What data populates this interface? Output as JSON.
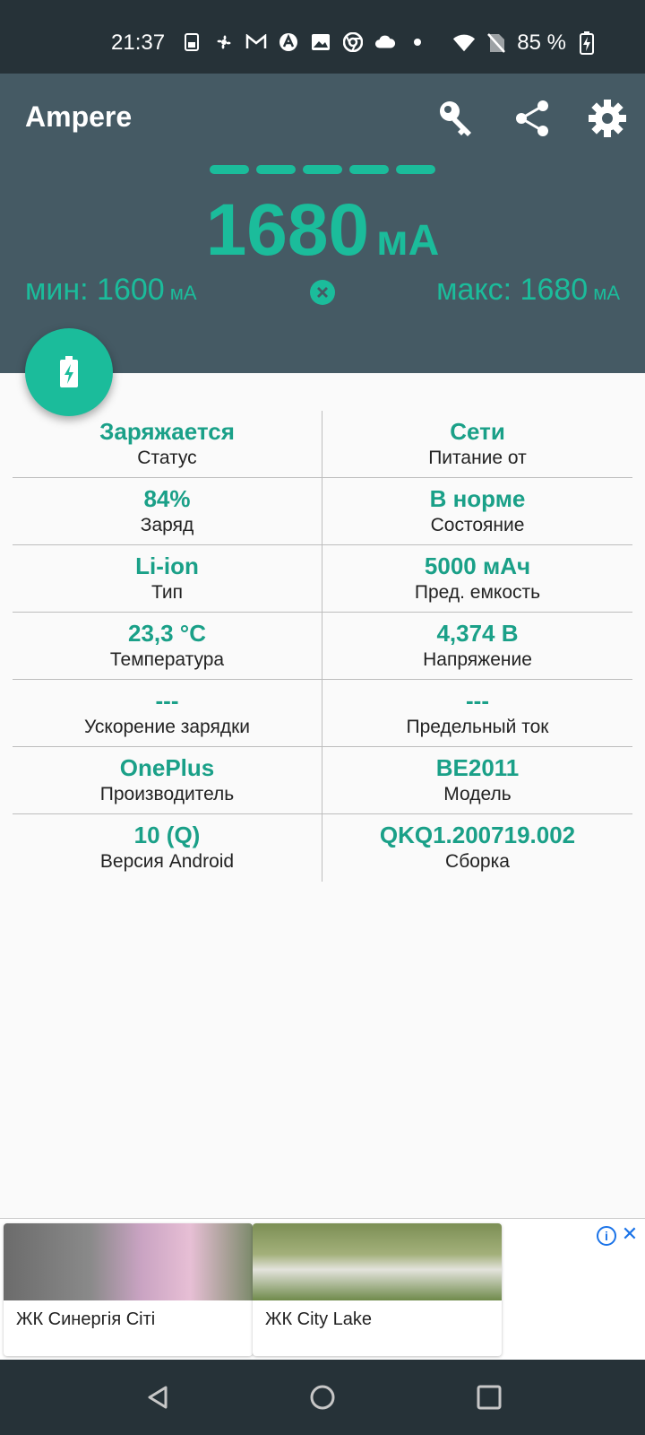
{
  "statusbar": {
    "time": "21:37",
    "battery_percent": "85 %",
    "icons": [
      "sim-icon",
      "fan-icon",
      "gmail-icon",
      "a-icon",
      "image-icon",
      "chrome-icon",
      "cloud-icon",
      "dot-icon"
    ]
  },
  "header": {
    "app_title": "Ampere",
    "current_value": "1680",
    "current_unit": "мА",
    "min_label": "мин: 1600",
    "min_unit": "мА",
    "max_label": "макс: 1680",
    "max_unit": "мА",
    "dashes_count_note": 5
  },
  "grid": [
    [
      {
        "value": "Заряжается",
        "label": "Статус"
      },
      {
        "value": "Сети",
        "label": "Питание от"
      }
    ],
    [
      {
        "value": "84%",
        "label": "Заряд"
      },
      {
        "value": "В норме",
        "label": "Состояние"
      }
    ],
    [
      {
        "value": "Li-ion",
        "label": "Тип"
      },
      {
        "value": "5000 мАч",
        "label": "Пред. емкость"
      }
    ],
    [
      {
        "value": "23,3 °C",
        "label": "Температура"
      },
      {
        "value": "4,374 В",
        "label": "Напряжение"
      }
    ],
    [
      {
        "value": "---",
        "label": "Ускорение зарядки"
      },
      {
        "value": "---",
        "label": "Предельный ток"
      }
    ],
    [
      {
        "value": "OnePlus",
        "label": "Производитель"
      },
      {
        "value": "BE2011",
        "label": "Модель"
      }
    ],
    [
      {
        "value": "10 (Q)",
        "label": "Версия Android"
      },
      {
        "value": "QKQ1.200719.002",
        "label": "Сборка"
      }
    ]
  ],
  "ad": {
    "card_a": "ЖК Синергія Сіті",
    "card_b": "ЖК City Lake",
    "info": "i",
    "close": "✕"
  },
  "colors": {
    "accent": "#1bbc9b",
    "header_bg": "#455a64",
    "statusbar_bg": "#263238"
  }
}
